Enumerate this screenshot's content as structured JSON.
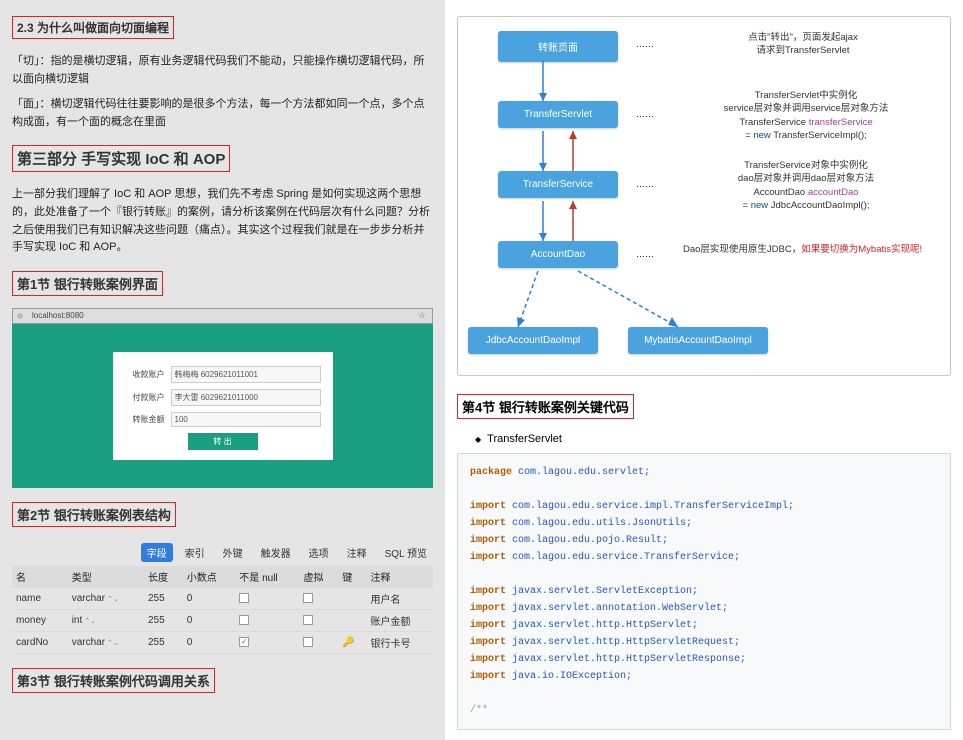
{
  "left": {
    "sec23": "2.3 为什么叫做面向切面编程",
    "para1": "「切」：指的是横切逻辑，原有业务逻辑代码我们不能动，只能操作横切逻辑代码，所以面向横切逻辑",
    "para2": "「面」：横切逻辑代码往往要影响的是很多个方法，每一个方法都如同一个点，多个点构成面，有一个面的概念在里面",
    "part3": "第三部分 手写实现 IoC 和 AOP",
    "para3": "上一部分我们理解了 IoC 和 AOP 思想，我们先不考虑 Spring 是如何实现这两个思想的，此处准备了一个『银行转账』的案例，请分析该案例在代码层次有什么问题？分析之后使用我们已有知识解决这些问题（痛点）。其实这个过程我们就是在一步步分析并手写实现 IoC 和 AOP。",
    "sec1": "第1节 银行转账案例界面",
    "url": "localhost:8080",
    "form": {
      "lbl1": "收款账户",
      "val1": "韩梅梅 6029621011001",
      "lbl2": "付款账户",
      "val2": "李大雷 6029621011000",
      "lbl3": "转账金额",
      "val3": "100",
      "btn": "转 出"
    },
    "sec2": "第2节 银行转账案例表结构",
    "tabs": {
      "t1": "字段",
      "t2": "索引",
      "t3": "外键",
      "t4": "触发器",
      "t5": "选项",
      "t6": "注释",
      "t7": "SQL 预览"
    },
    "th": {
      "c1": "名",
      "c2": "类型",
      "c3": "长度",
      "c4": "小数点",
      "c5": "不是 null",
      "c6": "虚拟",
      "c7": "键",
      "c8": "注释"
    },
    "rows": [
      {
        "name": "name",
        "type": "varchar",
        "len": "255",
        "dec": "0",
        "notnull": false,
        "virt": false,
        "key": "",
        "note": "用户名"
      },
      {
        "name": "money",
        "type": "int",
        "len": "255",
        "dec": "0",
        "notnull": false,
        "virt": false,
        "key": "",
        "note": "账户金额"
      },
      {
        "name": "cardNo",
        "type": "varchar",
        "len": "255",
        "dec": "0",
        "notnull": true,
        "virt": false,
        "key": "key",
        "note": "银行卡号"
      }
    ],
    "sec3": "第3节 银行转账案例代码调用关系"
  },
  "right": {
    "nodes": {
      "n1": "转账页面",
      "n2": "TransferServlet",
      "n3": "TransferService",
      "n4": "AccountDao",
      "n5": "JdbcAccountDaoImpl",
      "n6": "MybatisAccountDaoImpl"
    },
    "dots": "……",
    "desc1a": "点击\"转出\"，页面发起ajax",
    "desc1b": "请求到TransferServlet",
    "desc2a": "TransferServlet中实例化",
    "desc2b": "service层对象并调用service层对象方法",
    "desc2c_lhs": "TransferService ",
    "desc2c_var": "transferService",
    "desc2d_eq": "          = ",
    "desc2d_new": "new",
    "desc2d_cls": " TransferServiceImpl();",
    "desc3a": "TransferService对象中实例化",
    "desc3b": "dao层对象并调用dao层对象方法",
    "desc3c_lhs": "AccountDao ",
    "desc3c_var": "accountDao",
    "desc3d_eq": "          = ",
    "desc3d_new": "new",
    "desc3d_cls": " JdbcAccountDaoImpl();",
    "desc4a": "Dao层实现使用原生JDBC，",
    "desc4b": "如果要切换为Mybatis实现呢!",
    "sec4": "第4节 银行转账案例关键代码",
    "bullet": "TransferServlet",
    "code": {
      "l1_kw": "package",
      "l1_rest": " com.lagou.edu.servlet;",
      "l2_kw": "import",
      "l2_rest": " com.lagou.edu.service.impl.TransferServiceImpl;",
      "l3_kw": "import",
      "l3_rest": " com.lagou.edu.utils.JsonUtils;",
      "l4_kw": "import",
      "l4_rest": " com.lagou.edu.pojo.Result;",
      "l5_kw": "import",
      "l5_rest": " com.lagou.edu.service.TransferService;",
      "l6_kw": "import",
      "l6_rest": " javax.servlet.ServletException;",
      "l7_kw": "import",
      "l7_rest": " javax.servlet.annotation.WebServlet;",
      "l8_kw": "import",
      "l8_rest": " javax.servlet.http.HttpServlet;",
      "l9_kw": "import",
      "l9_rest": " javax.servlet.http.HttpServletRequest;",
      "l10_kw": "import",
      "l10_rest": " javax.servlet.http.HttpServletResponse;",
      "l11_kw": "import",
      "l11_rest": " java.io.IOException;",
      "l12": "/**"
    }
  }
}
